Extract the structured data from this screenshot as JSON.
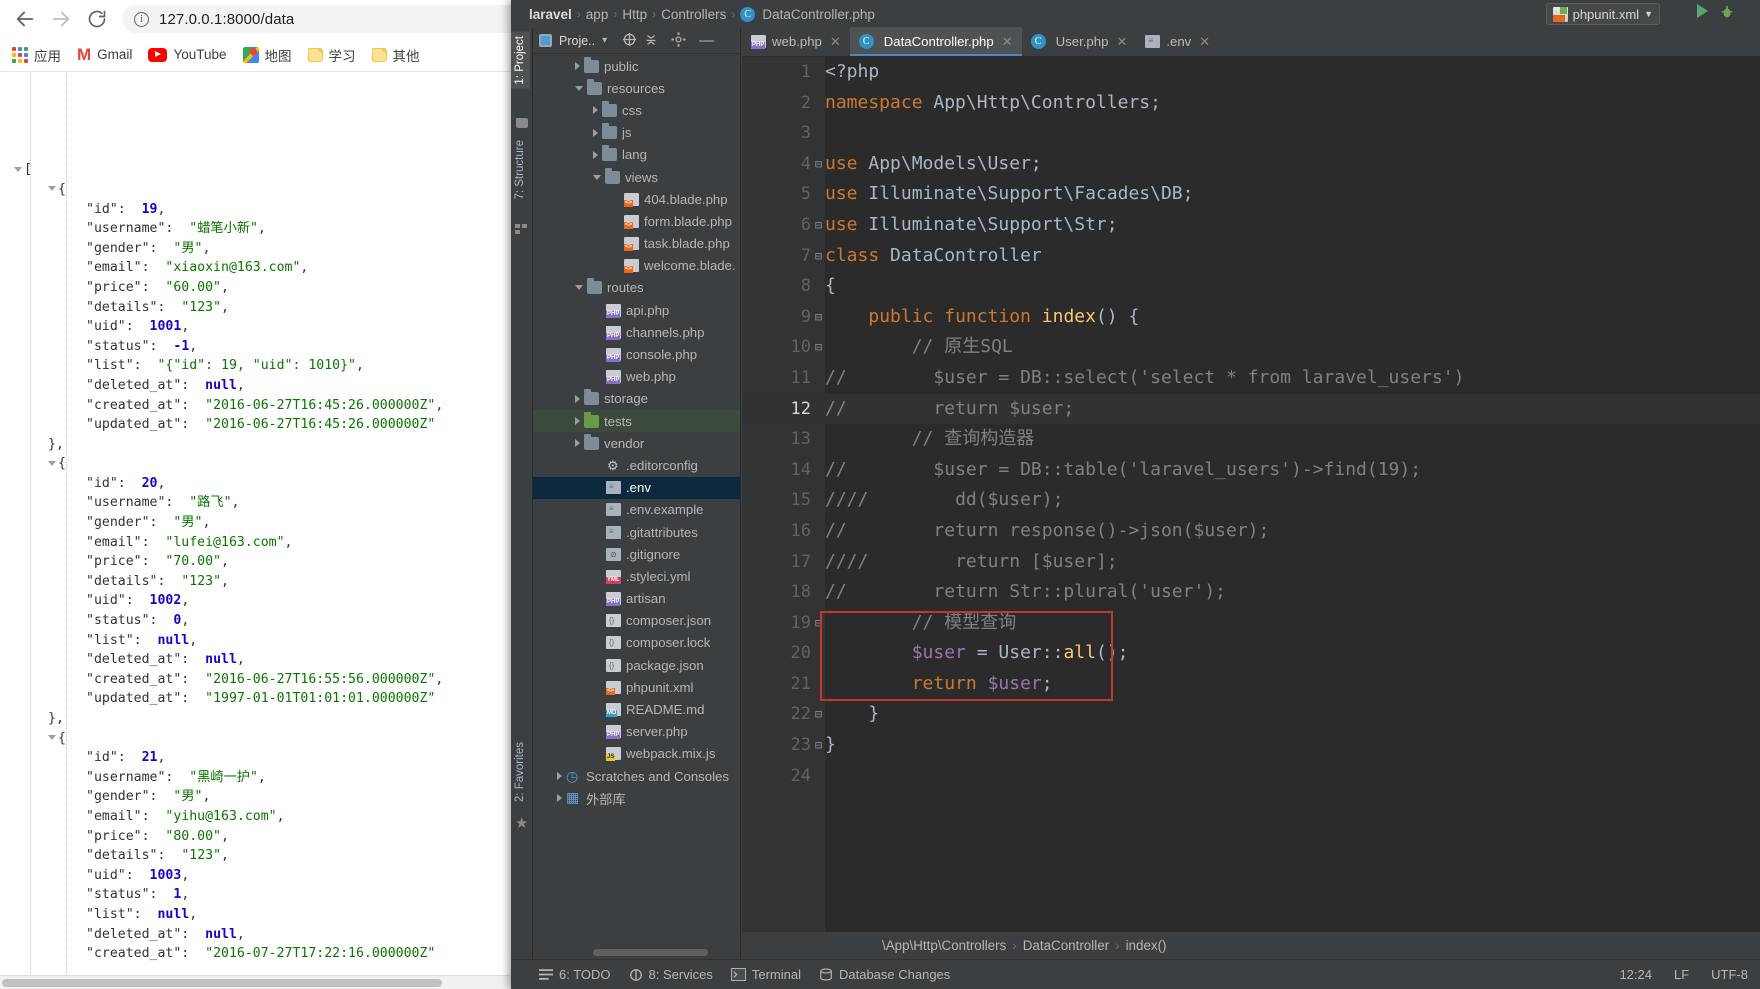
{
  "browser": {
    "nav": {
      "back": "back-arrow",
      "forward": "forward-arrow",
      "reload": "reload-icon"
    },
    "omnibox": {
      "url": "127.0.0.1:8000/data",
      "info_icon": "info-circle-icon"
    },
    "bookmarks": [
      {
        "label": "应用",
        "icon": "apps-grid-icon"
      },
      {
        "label": "Gmail",
        "icon": "gmail-icon"
      },
      {
        "label": "YouTube",
        "icon": "youtube-icon"
      },
      {
        "label": "地图",
        "icon": "google-maps-icon"
      },
      {
        "label": "学习",
        "icon": "folder-icon"
      },
      {
        "label": "其他",
        "icon": "folder-icon"
      }
    ],
    "json_response": [
      {
        "id": 19,
        "username": "蜡笔小新",
        "gender": "男",
        "email": "xiaoxin@163.com",
        "price": "60.00",
        "details": "123",
        "uid": 1001,
        "status": -1,
        "list": "{\"id\": 19, \"uid\": 1010}",
        "deleted_at": null,
        "created_at": "2016-06-27T16:45:26.000000Z",
        "updated_at": "2016-06-27T16:45:26.000000Z"
      },
      {
        "id": 20,
        "username": "路飞",
        "gender": "男",
        "email": "lufei@163.com",
        "price": "70.00",
        "details": "123",
        "uid": 1002,
        "status": 0,
        "list": null,
        "deleted_at": null,
        "created_at": "2016-06-27T16:55:56.000000Z",
        "updated_at": "1997-01-01T01:01:01.000000Z"
      },
      {
        "id": 21,
        "username": "黑崎一护",
        "gender": "男",
        "email": "yihu@163.com",
        "price": "80.00",
        "details": "123",
        "uid": 1003,
        "status": 1,
        "list": null,
        "deleted_at": null,
        "created_at": "2016-07-27T17:22:16.000000Z"
      }
    ]
  },
  "ide": {
    "breadcrumb": [
      "laravel",
      "app",
      "Http",
      "Controllers",
      "DataController.php"
    ],
    "run_config": {
      "label": "phpunit.xml",
      "icon": "xml-file-icon"
    },
    "toolbar_icons": [
      "run-icon",
      "debug-icon",
      "more-icon"
    ],
    "left_tool_tabs": [
      "1: Project",
      "7: Structure"
    ],
    "right_tool_tabs": [
      "2: Favorites"
    ],
    "project_panel": {
      "title": "Proje..",
      "header_icons": [
        "locate-icon",
        "collapse-all-icon",
        "settings-gear-icon",
        "hide-icon"
      ]
    },
    "tree": [
      {
        "label": "public",
        "depth": 2,
        "arrow": "closed",
        "icon": "folder"
      },
      {
        "label": "resources",
        "depth": 2,
        "arrow": "open",
        "icon": "folder"
      },
      {
        "label": "css",
        "depth": 3,
        "arrow": "closed",
        "icon": "folder"
      },
      {
        "label": "js",
        "depth": 3,
        "arrow": "closed",
        "icon": "folder"
      },
      {
        "label": "lang",
        "depth": 3,
        "arrow": "closed",
        "icon": "folder"
      },
      {
        "label": "views",
        "depth": 3,
        "arrow": "open",
        "icon": "folder"
      },
      {
        "label": "404.blade.php",
        "depth": 4,
        "arrow": "none",
        "icon": "blade"
      },
      {
        "label": "form.blade.php",
        "depth": 4,
        "arrow": "none",
        "icon": "blade"
      },
      {
        "label": "task.blade.php",
        "depth": 4,
        "arrow": "none",
        "icon": "blade"
      },
      {
        "label": "welcome.blade.",
        "depth": 4,
        "arrow": "none",
        "icon": "blade"
      },
      {
        "label": "routes",
        "depth": 2,
        "arrow": "open",
        "icon": "folder"
      },
      {
        "label": "api.php",
        "depth": 3,
        "arrow": "none",
        "icon": "php"
      },
      {
        "label": "channels.php",
        "depth": 3,
        "arrow": "none",
        "icon": "php"
      },
      {
        "label": "console.php",
        "depth": 3,
        "arrow": "none",
        "icon": "php"
      },
      {
        "label": "web.php",
        "depth": 3,
        "arrow": "none",
        "icon": "php"
      },
      {
        "label": "storage",
        "depth": 2,
        "arrow": "closed",
        "icon": "folder"
      },
      {
        "label": "tests",
        "depth": 2,
        "arrow": "closed",
        "icon": "folder-green",
        "state": "sel-green"
      },
      {
        "label": "vendor",
        "depth": 2,
        "arrow": "closed",
        "icon": "folder"
      },
      {
        "label": ".editorconfig",
        "depth": 3,
        "arrow": "none",
        "icon": "gear"
      },
      {
        "label": ".env",
        "depth": 3,
        "arrow": "none",
        "icon": "txt",
        "state": "sel-blue"
      },
      {
        "label": ".env.example",
        "depth": 3,
        "arrow": "none",
        "icon": "txt"
      },
      {
        "label": ".gitattributes",
        "depth": 3,
        "arrow": "none",
        "icon": "txt"
      },
      {
        "label": ".gitignore",
        "depth": 3,
        "arrow": "none",
        "icon": "gitignore"
      },
      {
        "label": ".styleci.yml",
        "depth": 3,
        "arrow": "none",
        "icon": "yml"
      },
      {
        "label": "artisan",
        "depth": 3,
        "arrow": "none",
        "icon": "php"
      },
      {
        "label": "composer.json",
        "depth": 3,
        "arrow": "none",
        "icon": "json"
      },
      {
        "label": "composer.lock",
        "depth": 3,
        "arrow": "none",
        "icon": "json"
      },
      {
        "label": "package.json",
        "depth": 3,
        "arrow": "none",
        "icon": "json"
      },
      {
        "label": "phpunit.xml",
        "depth": 3,
        "arrow": "none",
        "icon": "xmlf"
      },
      {
        "label": "README.md",
        "depth": 3,
        "arrow": "none",
        "icon": "md"
      },
      {
        "label": "server.php",
        "depth": 3,
        "arrow": "none",
        "icon": "php"
      },
      {
        "label": "webpack.mix.js",
        "depth": 3,
        "arrow": "none",
        "icon": "js"
      },
      {
        "label": "Scratches and Consoles",
        "depth": 1,
        "arrow": "closed",
        "icon": "scratch"
      },
      {
        "label": "外部库",
        "depth": 1,
        "arrow": "closed",
        "icon": "lib"
      }
    ],
    "editor_tabs": [
      {
        "label": "web.php",
        "icon": "php-file-icon",
        "active": false
      },
      {
        "label": "DataController.php",
        "icon": "php-class-icon",
        "active": true
      },
      {
        "label": "User.php",
        "icon": "php-class-icon",
        "active": false
      },
      {
        "label": ".env",
        "icon": "txt-file-icon",
        "active": false
      }
    ],
    "code_lines": [
      {
        "n": 1,
        "fold": "",
        "text": "<?php"
      },
      {
        "n": 2,
        "fold": "",
        "text": "namespace App\\Http\\Controllers;"
      },
      {
        "n": 3,
        "fold": "",
        "text": ""
      },
      {
        "n": 4,
        "fold": "-",
        "text": "use App\\Models\\User;"
      },
      {
        "n": 5,
        "fold": "",
        "text": "use Illuminate\\Support\\Facades\\DB;"
      },
      {
        "n": 6,
        "fold": "-",
        "text": "use Illuminate\\Support\\Str;"
      },
      {
        "n": 7,
        "fold": "-",
        "text": "class DataController"
      },
      {
        "n": 8,
        "fold": "",
        "text": "{"
      },
      {
        "n": 9,
        "fold": "-",
        "text": "    public function index() {"
      },
      {
        "n": 10,
        "fold": "-",
        "text": "        // 原生SQL"
      },
      {
        "n": 11,
        "fold": "",
        "text": "//        $user = DB::select('select * from laravel_users')"
      },
      {
        "n": 12,
        "fold": "",
        "text": "//        return $user;"
      },
      {
        "n": 13,
        "fold": "",
        "text": "        // 查询构造器"
      },
      {
        "n": 14,
        "fold": "",
        "text": "//        $user = DB::table('laravel_users')->find(19);"
      },
      {
        "n": 15,
        "fold": "",
        "text": "////        dd($user);"
      },
      {
        "n": 16,
        "fold": "",
        "text": "//        return response()->json($user);"
      },
      {
        "n": 17,
        "fold": "",
        "text": "////        return [$user];"
      },
      {
        "n": 18,
        "fold": "",
        "text": "//        return Str::plural('user');"
      },
      {
        "n": 19,
        "fold": "-",
        "text": "        // 模型查询"
      },
      {
        "n": 20,
        "fold": "",
        "text": "        $user = User::all();"
      },
      {
        "n": 21,
        "fold": "",
        "text": "        return $user;"
      },
      {
        "n": 22,
        "fold": "-",
        "text": "    }"
      },
      {
        "n": 23,
        "fold": "-",
        "text": "}"
      },
      {
        "n": 24,
        "fold": "",
        "text": ""
      }
    ],
    "current_line": 12,
    "highlight_box_color": "#c0392b",
    "editor_breadcrumb": [
      "\\App\\Http\\Controllers",
      "DataController",
      "index()"
    ],
    "bottom_bar": [
      {
        "label": "6: TODO",
        "icon": "todo-icon"
      },
      {
        "label": "8: Services",
        "icon": "services-icon"
      },
      {
        "label": "Terminal",
        "icon": "terminal-icon"
      },
      {
        "label": "Database Changes",
        "icon": "database-icon"
      }
    ],
    "status_right": [
      "12:24",
      "LF",
      "UTF-8"
    ]
  }
}
